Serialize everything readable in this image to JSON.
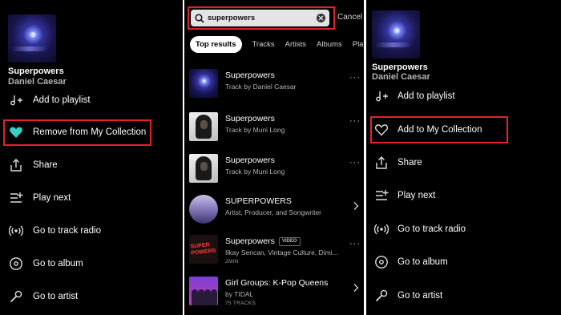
{
  "left": {
    "track": {
      "title": "Superpowers",
      "artist": "Daniel Caesar"
    },
    "menu": [
      {
        "label": "Add to playlist",
        "icon": "add-to-playlist-icon"
      },
      {
        "label": "Remove from My Collection",
        "icon": "heart-filled-icon"
      },
      {
        "label": "Share",
        "icon": "share-icon"
      },
      {
        "label": "Play next",
        "icon": "play-next-icon"
      },
      {
        "label": "Go to track radio",
        "icon": "radio-icon"
      },
      {
        "label": "Go to album",
        "icon": "album-icon"
      },
      {
        "label": "Go to artist",
        "icon": "artist-icon"
      }
    ]
  },
  "middle": {
    "search": {
      "query": "superpowers",
      "cancel": "Cancel"
    },
    "tabs": [
      "Top results",
      "Tracks",
      "Artists",
      "Albums",
      "Playlis"
    ],
    "results": [
      {
        "title": "Superpowers",
        "subtitle": "Track by Daniel Caesar",
        "action": "···"
      },
      {
        "title": "Superpowers",
        "subtitle": "Track by Muni Long",
        "action": "···"
      },
      {
        "title": "Superpowers",
        "subtitle": "Track by Muni Long",
        "action": "···"
      },
      {
        "title": "SUPERPOWERS",
        "subtitle": "Artist, Producer, and Songwriter"
      },
      {
        "title": "Superpowers",
        "badge": "VIDEO",
        "subtitle": "Ilkay Sencan, Vintage Culture, Dimi...",
        "meta": "2MIN",
        "action": "···"
      },
      {
        "title": "Girl Groups: K-Pop Queens",
        "subtitle": "by TIDAL",
        "meta": "75 TRACKS"
      }
    ],
    "thumb_text": "SUPER POWERS"
  },
  "right": {
    "track": {
      "title": "Superpowers",
      "artist": "Daniel Caesar"
    },
    "menu": [
      {
        "label": "Add to playlist",
        "icon": "add-to-playlist-icon"
      },
      {
        "label": "Add to My Collection",
        "icon": "heart-outline-icon"
      },
      {
        "label": "Share",
        "icon": "share-icon"
      },
      {
        "label": "Play next",
        "icon": "play-next-icon"
      },
      {
        "label": "Go to track radio",
        "icon": "radio-icon"
      },
      {
        "label": "Go to album",
        "icon": "album-icon"
      },
      {
        "label": "Go to artist",
        "icon": "artist-icon"
      }
    ]
  },
  "colors": {
    "background": "#000000",
    "accent": "#33d1c4",
    "highlight": "#e3222a"
  }
}
